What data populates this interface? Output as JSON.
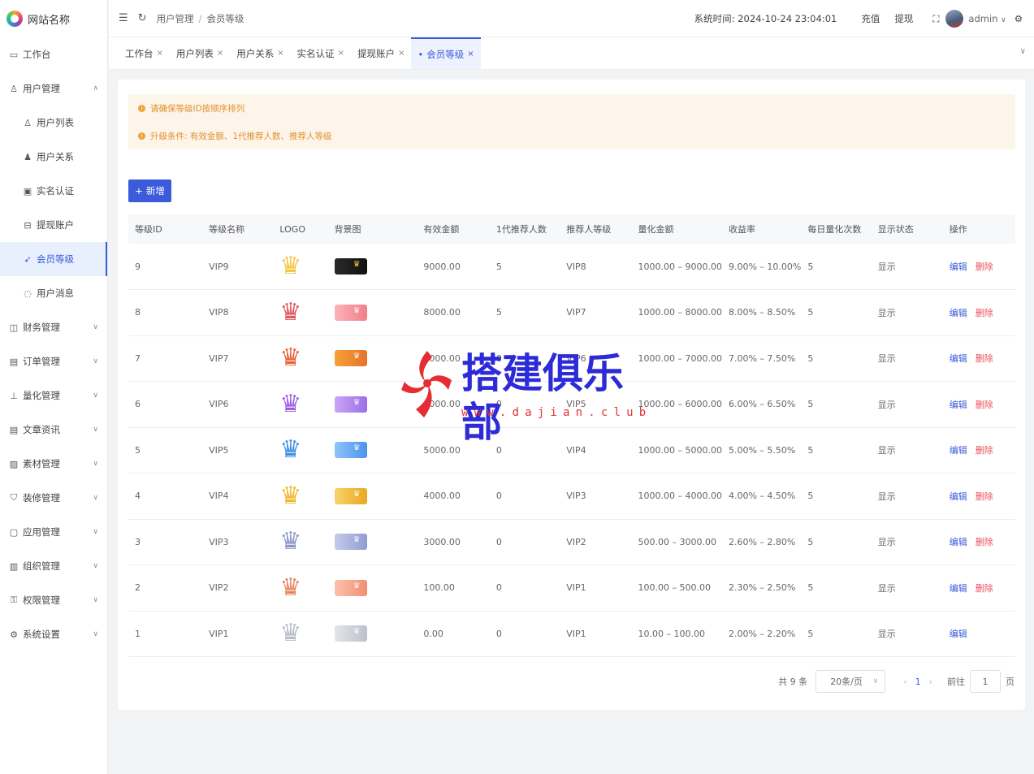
{
  "site": {
    "name": "网站名称"
  },
  "sidebar": {
    "items": [
      {
        "label": "工作台",
        "icon": "monitor-icon",
        "glyph": "▭",
        "expanded": null
      },
      {
        "label": "用户管理",
        "icon": "user-icon",
        "glyph": "♙",
        "expanded": true
      },
      {
        "label": "用户列表",
        "icon": "user-list-icon",
        "glyph": "♙",
        "sub": true
      },
      {
        "label": "用户关系",
        "icon": "user-relation-icon",
        "glyph": "♟",
        "sub": true
      },
      {
        "label": "实名认证",
        "icon": "id-card-icon",
        "glyph": "▣",
        "sub": true
      },
      {
        "label": "提现账户",
        "icon": "account-icon",
        "glyph": "⊟",
        "sub": true
      },
      {
        "label": "会员等级",
        "icon": "rocket-icon",
        "glyph": "➶",
        "sub": true,
        "active": true
      },
      {
        "label": "用户消息",
        "icon": "message-icon",
        "glyph": "◌",
        "sub": true
      },
      {
        "label": "财务管理",
        "icon": "chart-icon",
        "glyph": "◫",
        "expanded": false
      },
      {
        "label": "订单管理",
        "icon": "order-icon",
        "glyph": "▤",
        "expanded": false
      },
      {
        "label": "量化管理",
        "icon": "quant-icon",
        "glyph": "⊥",
        "expanded": false
      },
      {
        "label": "文章资讯",
        "icon": "article-icon",
        "glyph": "▤",
        "expanded": false
      },
      {
        "label": "素材管理",
        "icon": "material-icon",
        "glyph": "▨",
        "expanded": false
      },
      {
        "label": "装修管理",
        "icon": "decor-icon",
        "glyph": "⛉",
        "expanded": false
      },
      {
        "label": "应用管理",
        "icon": "app-icon",
        "glyph": "▢",
        "expanded": false
      },
      {
        "label": "组织管理",
        "icon": "org-icon",
        "glyph": "▥",
        "expanded": false
      },
      {
        "label": "权限管理",
        "icon": "lock-icon",
        "glyph": "⚿",
        "expanded": false
      },
      {
        "label": "系统设置",
        "icon": "settings-icon",
        "glyph": "⚙",
        "expanded": false
      }
    ]
  },
  "header": {
    "breadcrumb": [
      "用户管理",
      "会员等级"
    ],
    "system_time_label": "系统时间: 2024-10-24 23:04:01",
    "recharge": "充值",
    "withdraw": "提现",
    "user": "admin"
  },
  "tabs": [
    {
      "label": "工作台"
    },
    {
      "label": "用户列表"
    },
    {
      "label": "用户关系"
    },
    {
      "label": "实名认证"
    },
    {
      "label": "提现账户"
    },
    {
      "label": "会员等级",
      "active": true
    }
  ],
  "notice": {
    "lines": [
      "请确保等级ID按顺序排列",
      "升级条件: 有效金额、1代推荐人数、推荐人等级"
    ]
  },
  "toolbar": {
    "add_label": "新增"
  },
  "table": {
    "headers": [
      "等级ID",
      "等级名称",
      "LOGO",
      "背景图",
      "有效金额",
      "1代推荐人数",
      "推荐人等级",
      "量化金额",
      "收益率",
      "每日量化次数",
      "显示状态",
      "操作"
    ],
    "rows": [
      {
        "id": "9",
        "name": "VIP9",
        "crown_color": "#f5c542",
        "bg": [
          "#2a2a2a",
          "#111111"
        ],
        "amount": "9000.00",
        "refs": "5",
        "ref_level": "VIP8",
        "quant": "1000.00 – 9000.00",
        "rate": "9.00% – 10.00%",
        "times": "5",
        "status": "显示",
        "edit": "编辑",
        "del": "删除"
      },
      {
        "id": "8",
        "name": "VIP8",
        "crown_color": "#e0555f",
        "bg": [
          "#fbb3b8",
          "#f0808a"
        ],
        "amount": "8000.00",
        "refs": "5",
        "ref_level": "VIP7",
        "quant": "1000.00 – 8000.00",
        "rate": "8.00% – 8.50%",
        "times": "5",
        "status": "显示",
        "edit": "编辑",
        "del": "删除"
      },
      {
        "id": "7",
        "name": "VIP7",
        "crown_color": "#e8613a",
        "bg": [
          "#f6a13a",
          "#e5732a"
        ],
        "amount": "7000.00",
        "refs": "0",
        "ref_level": "VIP6",
        "quant": "1000.00 – 7000.00",
        "rate": "7.00% – 7.50%",
        "times": "5",
        "status": "显示",
        "edit": "编辑",
        "del": "删除"
      },
      {
        "id": "6",
        "name": "VIP6",
        "crown_color": "#9b5de5",
        "bg": [
          "#c8a6f5",
          "#9c6ee8"
        ],
        "amount": "6000.00",
        "refs": "0",
        "ref_level": "VIP5",
        "quant": "1000.00 – 6000.00",
        "rate": "6.00% – 6.50%",
        "times": "5",
        "status": "显示",
        "edit": "编辑",
        "del": "删除"
      },
      {
        "id": "5",
        "name": "VIP5",
        "crown_color": "#3c8de5",
        "bg": [
          "#8ec5fa",
          "#4c93ea"
        ],
        "amount": "5000.00",
        "refs": "0",
        "ref_level": "VIP4",
        "quant": "1000.00 – 5000.00",
        "rate": "5.00% – 5.50%",
        "times": "5",
        "status": "显示",
        "edit": "编辑",
        "del": "删除"
      },
      {
        "id": "4",
        "name": "VIP4",
        "crown_color": "#f2b72a",
        "bg": [
          "#f9d36a",
          "#e9a722"
        ],
        "amount": "4000.00",
        "refs": "0",
        "ref_level": "VIP3",
        "quant": "1000.00 – 4000.00",
        "rate": "4.00% – 4.50%",
        "times": "5",
        "status": "显示",
        "edit": "编辑",
        "del": "删除"
      },
      {
        "id": "3",
        "name": "VIP3",
        "crown_color": "#8d95c4",
        "bg": [
          "#c5cbea",
          "#929bd0"
        ],
        "amount": "3000.00",
        "refs": "0",
        "ref_level": "VIP2",
        "quant": "500.00 – 3000.00",
        "rate": "2.60% – 2.80%",
        "times": "5",
        "status": "显示",
        "edit": "编辑",
        "del": "删除"
      },
      {
        "id": "2",
        "name": "VIP2",
        "crown_color": "#e8835f",
        "bg": [
          "#fbc2ad",
          "#f08f72"
        ],
        "amount": "100.00",
        "refs": "0",
        "ref_level": "VIP1",
        "quant": "100.00 – 500.00",
        "rate": "2.30% – 2.50%",
        "times": "5",
        "status": "显示",
        "edit": "编辑",
        "del": "删除"
      },
      {
        "id": "1",
        "name": "VIP1",
        "crown_color": "#b8bcc6",
        "bg": [
          "#e3e5ea",
          "#bcc0ca"
        ],
        "amount": "0.00",
        "refs": "0",
        "ref_level": "VIP1",
        "quant": "10.00 – 100.00",
        "rate": "2.00% – 2.20%",
        "times": "5",
        "status": "显示",
        "edit": "编辑",
        "del": null
      }
    ]
  },
  "pagination": {
    "total": "共 9 条",
    "page_size": "20条/页",
    "current": "1",
    "goto_label": "前往",
    "goto_value": "1",
    "page_suffix": "页"
  },
  "watermark": {
    "title": "搭建俱乐部",
    "url": "www.dajian.club"
  },
  "colors": {
    "accent": "#3b5bdb",
    "danger": "#e8525e",
    "warning": "#f0a13a"
  }
}
